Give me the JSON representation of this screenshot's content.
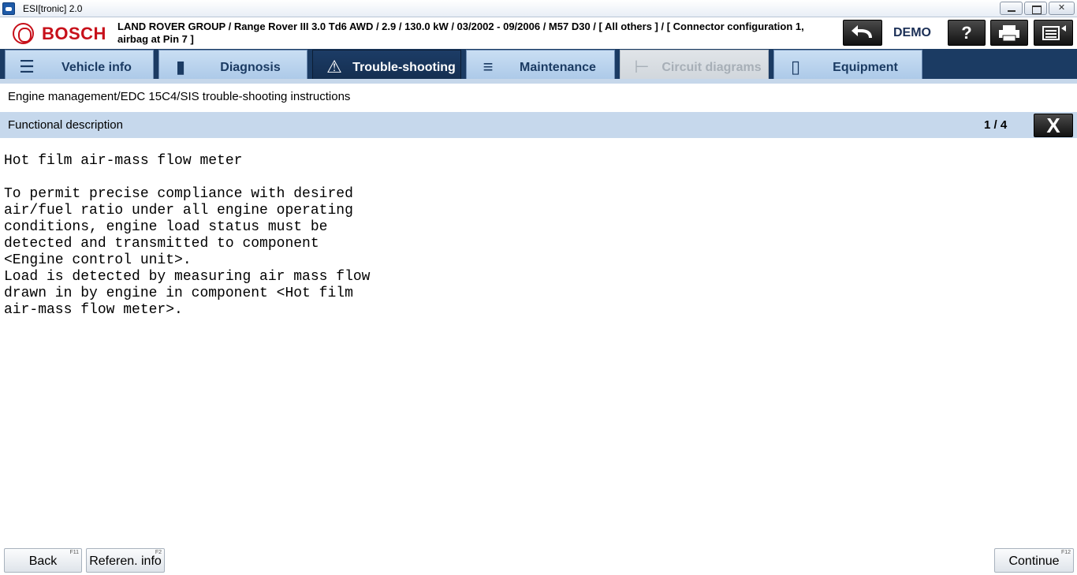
{
  "window": {
    "title": "ESI[tronic] 2.0"
  },
  "header": {
    "brand": "BOSCH",
    "vehicle": "LAND ROVER GROUP / Range Rover III 3.0 Td6 AWD / 2.9 / 130.0 kW / 03/2002 - 09/2006 / M57 D30 / [ All others ] / [ Connector configuration 1, airbag at Pin 7 ]",
    "mode": "DEMO",
    "icons": {
      "back": "undo-arrow-icon",
      "help": "question-icon",
      "print": "printer-icon",
      "menu": "list-menu-icon"
    }
  },
  "tabs": [
    {
      "label": "Vehicle info",
      "icon": "car-info-icon",
      "state": "normal"
    },
    {
      "label": "Diagnosis",
      "icon": "diagnosis-plug-icon",
      "state": "normal"
    },
    {
      "label": "Trouble-shooting",
      "icon": "magnifier-warning-icon",
      "state": "active"
    },
    {
      "label": "Maintenance",
      "icon": "wrench-icon",
      "state": "normal"
    },
    {
      "label": "Circuit diagrams",
      "icon": "circuit-icon",
      "state": "disabled"
    },
    {
      "label": "Equipment",
      "icon": "book-icon",
      "state": "normal"
    }
  ],
  "breadcrumb": "Engine management/EDC 15C4/SIS trouble-shooting instructions",
  "section": {
    "title": "Functional description",
    "page": "1 / 4"
  },
  "content": {
    "text": "Hot film air-mass flow meter\n\nTo permit precise compliance with desired\nair/fuel ratio under all engine operating\nconditions, engine load status must be\ndetected and transmitted to component\n<Engine control unit>.\nLoad is detected by measuring air mass flow\ndrawn in by engine in component <Hot film\nair-mass flow meter>."
  },
  "footer": {
    "back": {
      "label": "Back",
      "key": "F11"
    },
    "reference": {
      "label": "Referen. info",
      "key": "F2"
    },
    "continue": {
      "label": "Continue",
      "key": "F12"
    }
  },
  "colors": {
    "brand_red": "#c7101a",
    "tab_active": "#1c3c66",
    "tab_normal": "#b9d3ee",
    "section_bar": "#c6d8ec"
  }
}
